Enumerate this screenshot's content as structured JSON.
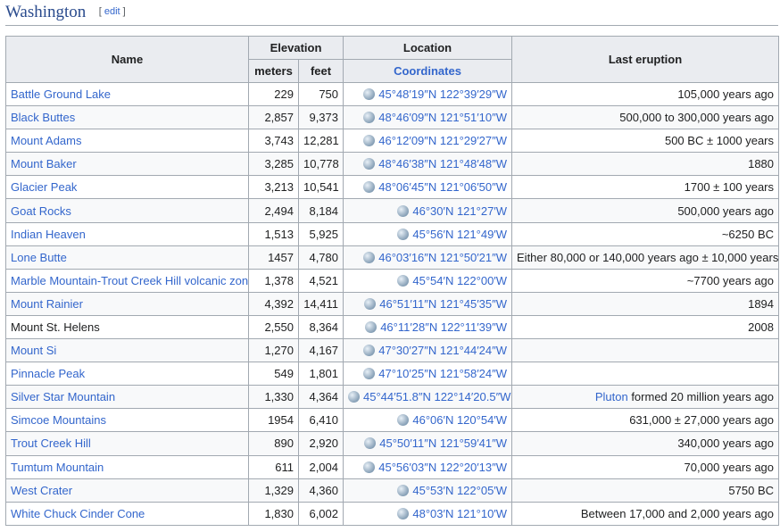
{
  "section": {
    "title": "Washington",
    "edit_open": "[ ",
    "edit_label": "edit",
    "edit_close": " ]"
  },
  "headers": {
    "name": "Name",
    "elevation": "Elevation",
    "meters": "meters",
    "feet": "feet",
    "location": "Location",
    "coordinates": "Coordinates",
    "last_eruption": "Last eruption"
  },
  "rows": [
    {
      "name": "Battle Ground Lake",
      "name_link": true,
      "meters": "229",
      "feet": "750",
      "coords": "45°48′19″N 122°39′29″W",
      "eruption_link": "",
      "eruption": "105,000 years ago"
    },
    {
      "name": "Black Buttes",
      "name_link": true,
      "meters": "2,857",
      "feet": "9,373",
      "coords": "48°46′09″N 121°51′10″W",
      "eruption_link": "",
      "eruption": "500,000 to 300,000 years ago"
    },
    {
      "name": "Mount Adams",
      "name_link": true,
      "meters": "3,743",
      "feet": "12,281",
      "coords": "46°12′09″N 121°29′27″W",
      "eruption_link": "",
      "eruption": "500 BC ± 1000 years"
    },
    {
      "name": "Mount Baker",
      "name_link": true,
      "meters": "3,285",
      "feet": "10,778",
      "coords": "48°46′38″N 121°48′48″W",
      "eruption_link": "",
      "eruption": "1880"
    },
    {
      "name": "Glacier Peak",
      "name_link": true,
      "meters": "3,213",
      "feet": "10,541",
      "coords": "48°06′45″N 121°06′50″W",
      "eruption_link": "",
      "eruption": "1700 ± 100 years"
    },
    {
      "name": "Goat Rocks",
      "name_link": true,
      "meters": "2,494",
      "feet": "8,184",
      "coords": "46°30′N 121°27′W",
      "eruption_link": "",
      "eruption": "500,000 years ago"
    },
    {
      "name": "Indian Heaven",
      "name_link": true,
      "meters": "1,513",
      "feet": "5,925",
      "coords": "45°56′N 121°49′W",
      "eruption_link": "",
      "eruption": "~6250 BC"
    },
    {
      "name": "Lone Butte",
      "name_link": true,
      "meters": "1457",
      "feet": "4,780",
      "coords": "46°03′16″N 121°50′21″W",
      "eruption_link": "",
      "eruption": "Either 80,000 or 140,000 years ago ± 10,000 years"
    },
    {
      "name": "Marble Mountain-Trout Creek Hill volcanic zone",
      "name_link": true,
      "meters": "1,378",
      "feet": "4,521",
      "coords": "45°54′N 122°00′W",
      "eruption_link": "",
      "eruption": "~7700 years ago"
    },
    {
      "name": "Mount Rainier",
      "name_link": true,
      "meters": "4,392",
      "feet": "14,411",
      "coords": "46°51′11″N 121°45′35″W",
      "eruption_link": "",
      "eruption": "1894"
    },
    {
      "name": "Mount St. Helens",
      "name_link": false,
      "meters": "2,550",
      "feet": "8,364",
      "coords": "46°11′28″N 122°11′39″W",
      "eruption_link": "",
      "eruption": "2008"
    },
    {
      "name": "Mount Si",
      "name_link": true,
      "meters": "1,270",
      "feet": "4,167",
      "coords": "47°30′27″N 121°44′24″W",
      "eruption_link": "",
      "eruption": ""
    },
    {
      "name": "Pinnacle Peak",
      "name_link": true,
      "meters": "549",
      "feet": "1,801",
      "coords": "47°10′25″N 121°58′24″W",
      "eruption_link": "",
      "eruption": ""
    },
    {
      "name": "Silver Star Mountain",
      "name_link": true,
      "meters": "1,330",
      "feet": "4,364",
      "coords": "45°44′51.8″N 122°14′20.5″W",
      "eruption_link": "Pluton",
      "eruption": " formed 20 million years ago"
    },
    {
      "name": "Simcoe Mountains",
      "name_link": true,
      "meters": "1954",
      "feet": "6,410",
      "coords": "46°06′N 120°54′W",
      "eruption_link": "",
      "eruption": "631,000 ± 27,000 years ago"
    },
    {
      "name": "Trout Creek Hill",
      "name_link": true,
      "meters": "890",
      "feet": "2,920",
      "coords": "45°50′11″N 121°59′41″W",
      "eruption_link": "",
      "eruption": "340,000 years ago"
    },
    {
      "name": "Tumtum Mountain",
      "name_link": true,
      "meters": "611",
      "feet": "2,004",
      "coords": "45°56′03″N 122°20′13″W",
      "eruption_link": "",
      "eruption": "70,000 years ago"
    },
    {
      "name": "West Crater",
      "name_link": true,
      "meters": "1,329",
      "feet": "4,360",
      "coords": "45°53′N 122°05′W",
      "eruption_link": "",
      "eruption": "5750 BC"
    },
    {
      "name": "White Chuck Cinder Cone",
      "name_link": true,
      "meters": "1,830",
      "feet": "6,002",
      "coords": "48°03′N 121°10′W",
      "eruption_link": "",
      "eruption": "Between 17,000 and 2,000 years ago"
    }
  ]
}
